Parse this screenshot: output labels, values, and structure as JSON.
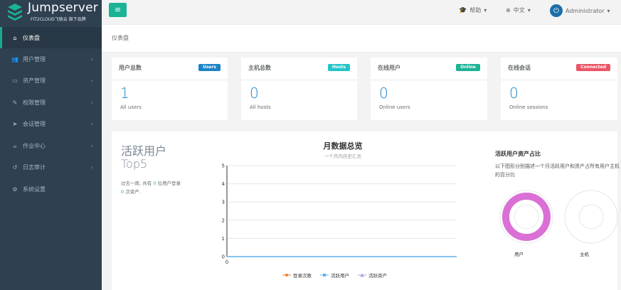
{
  "brand": {
    "title": "Jumpserver",
    "subtitle": "FIT2CLOUD飞致云 旗下品牌"
  },
  "sidebar": {
    "items": [
      {
        "label": "仪表盘",
        "icon": "home-icon",
        "active": true,
        "submenu": false
      },
      {
        "label": "用户管理",
        "icon": "users-icon",
        "active": false,
        "submenu": true
      },
      {
        "label": "资产管理",
        "icon": "inbox-icon",
        "active": false,
        "submenu": true
      },
      {
        "label": "权限管理",
        "icon": "edit-icon",
        "active": false,
        "submenu": true
      },
      {
        "label": "会话管理",
        "icon": "rocket-icon",
        "active": false,
        "submenu": true
      },
      {
        "label": "作业中心",
        "icon": "coffee-icon",
        "active": false,
        "submenu": true
      },
      {
        "label": "日志审计",
        "icon": "history-icon",
        "active": false,
        "submenu": true
      },
      {
        "label": "系统设置",
        "icon": "gears-icon",
        "active": false,
        "submenu": false
      }
    ]
  },
  "topbar": {
    "help": "帮助",
    "language": "中文",
    "user": "Administrator"
  },
  "breadcrumb": "仪表盘",
  "cards": [
    {
      "title": "用户总数",
      "badge": "Users",
      "badge_color": "#1c84c6",
      "value": "1",
      "sub": "All users"
    },
    {
      "title": "主机总数",
      "badge": "Hosts",
      "badge_color": "#23c6c8",
      "value": "0",
      "sub": "All hosts"
    },
    {
      "title": "在线用户",
      "badge": "Online",
      "badge_color": "#1ab394",
      "value": "0",
      "sub": "Online users"
    },
    {
      "title": "在线会话",
      "badge": "Connected",
      "badge_color": "#ed5565",
      "value": "0",
      "sub": "Online sessions"
    }
  ],
  "active_users": {
    "title_line1": "活跃用户",
    "title_line2": "Top5",
    "desc_prefix": "过去一周, 共有",
    "desc_count1": "0",
    "desc_middle": "位用户登录",
    "desc_count2": "0",
    "desc_suffix": "次资产."
  },
  "chart_data": {
    "type": "line",
    "title": "月数据总览",
    "subtitle": "一个月内历史汇总",
    "x": [
      "0"
    ],
    "ylim": [
      0,
      5
    ],
    "yticks": [
      0,
      1,
      2,
      3,
      4,
      5
    ],
    "series": [
      {
        "name": "登录次数",
        "color": "#ed7d31",
        "values": [
          0
        ]
      },
      {
        "name": "活跃用户",
        "color": "#5ab1ef",
        "values": [
          0
        ]
      },
      {
        "name": "活跃资产",
        "color": "#b6a2de",
        "values": [
          0
        ]
      }
    ],
    "grid": true,
    "legend": "bottom"
  },
  "pie_section": {
    "title": "活跃用户资产占比",
    "desc": "以下图形分别描述一个月活跃用户和资产占所有用户主机的百分比",
    "pies": [
      {
        "label": "用户",
        "color": "#da70d6",
        "filled": true
      },
      {
        "label": "主机",
        "color": "#e0e0e0",
        "filled": false
      }
    ]
  }
}
